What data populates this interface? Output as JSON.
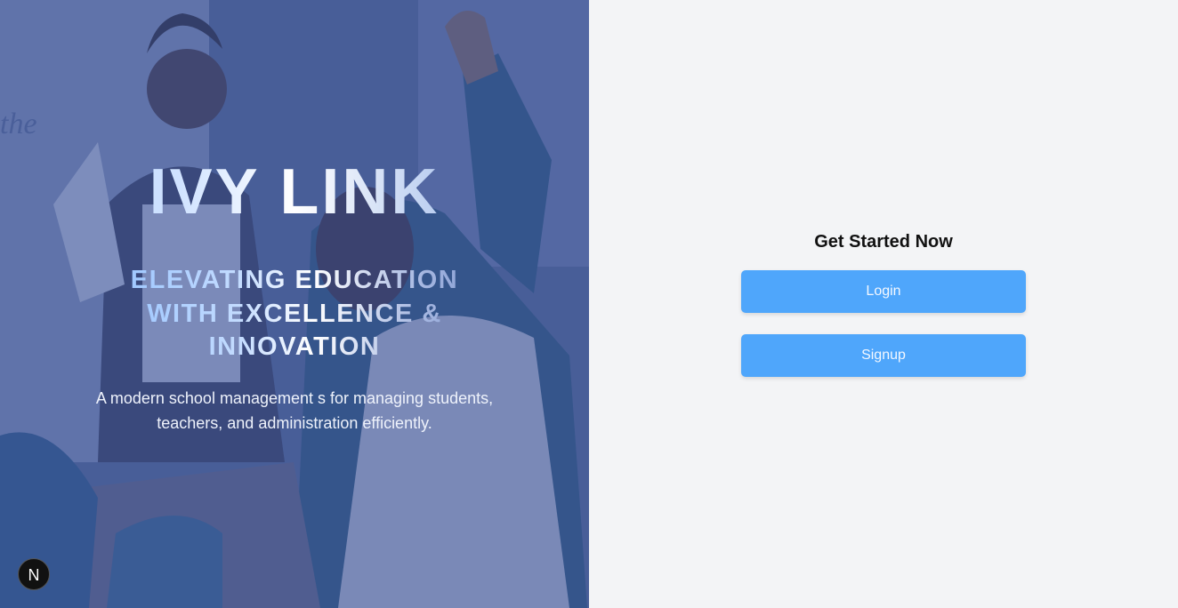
{
  "hero": {
    "brand": "IVY LINK",
    "tagline": "ELEVATING EDUCATION WITH EXCELLENCE & INNOVATION",
    "description": "A modern school management s for managing students, teachers, and administration efficiently.",
    "image_description_icon": "classroom-photo",
    "overlay_color": "#3a5296"
  },
  "dev_badge": {
    "label": "N"
  },
  "panel": {
    "title": "Get Started Now",
    "login_label": "Login",
    "signup_label": "Signup",
    "button_color": "#4fa6fb"
  }
}
